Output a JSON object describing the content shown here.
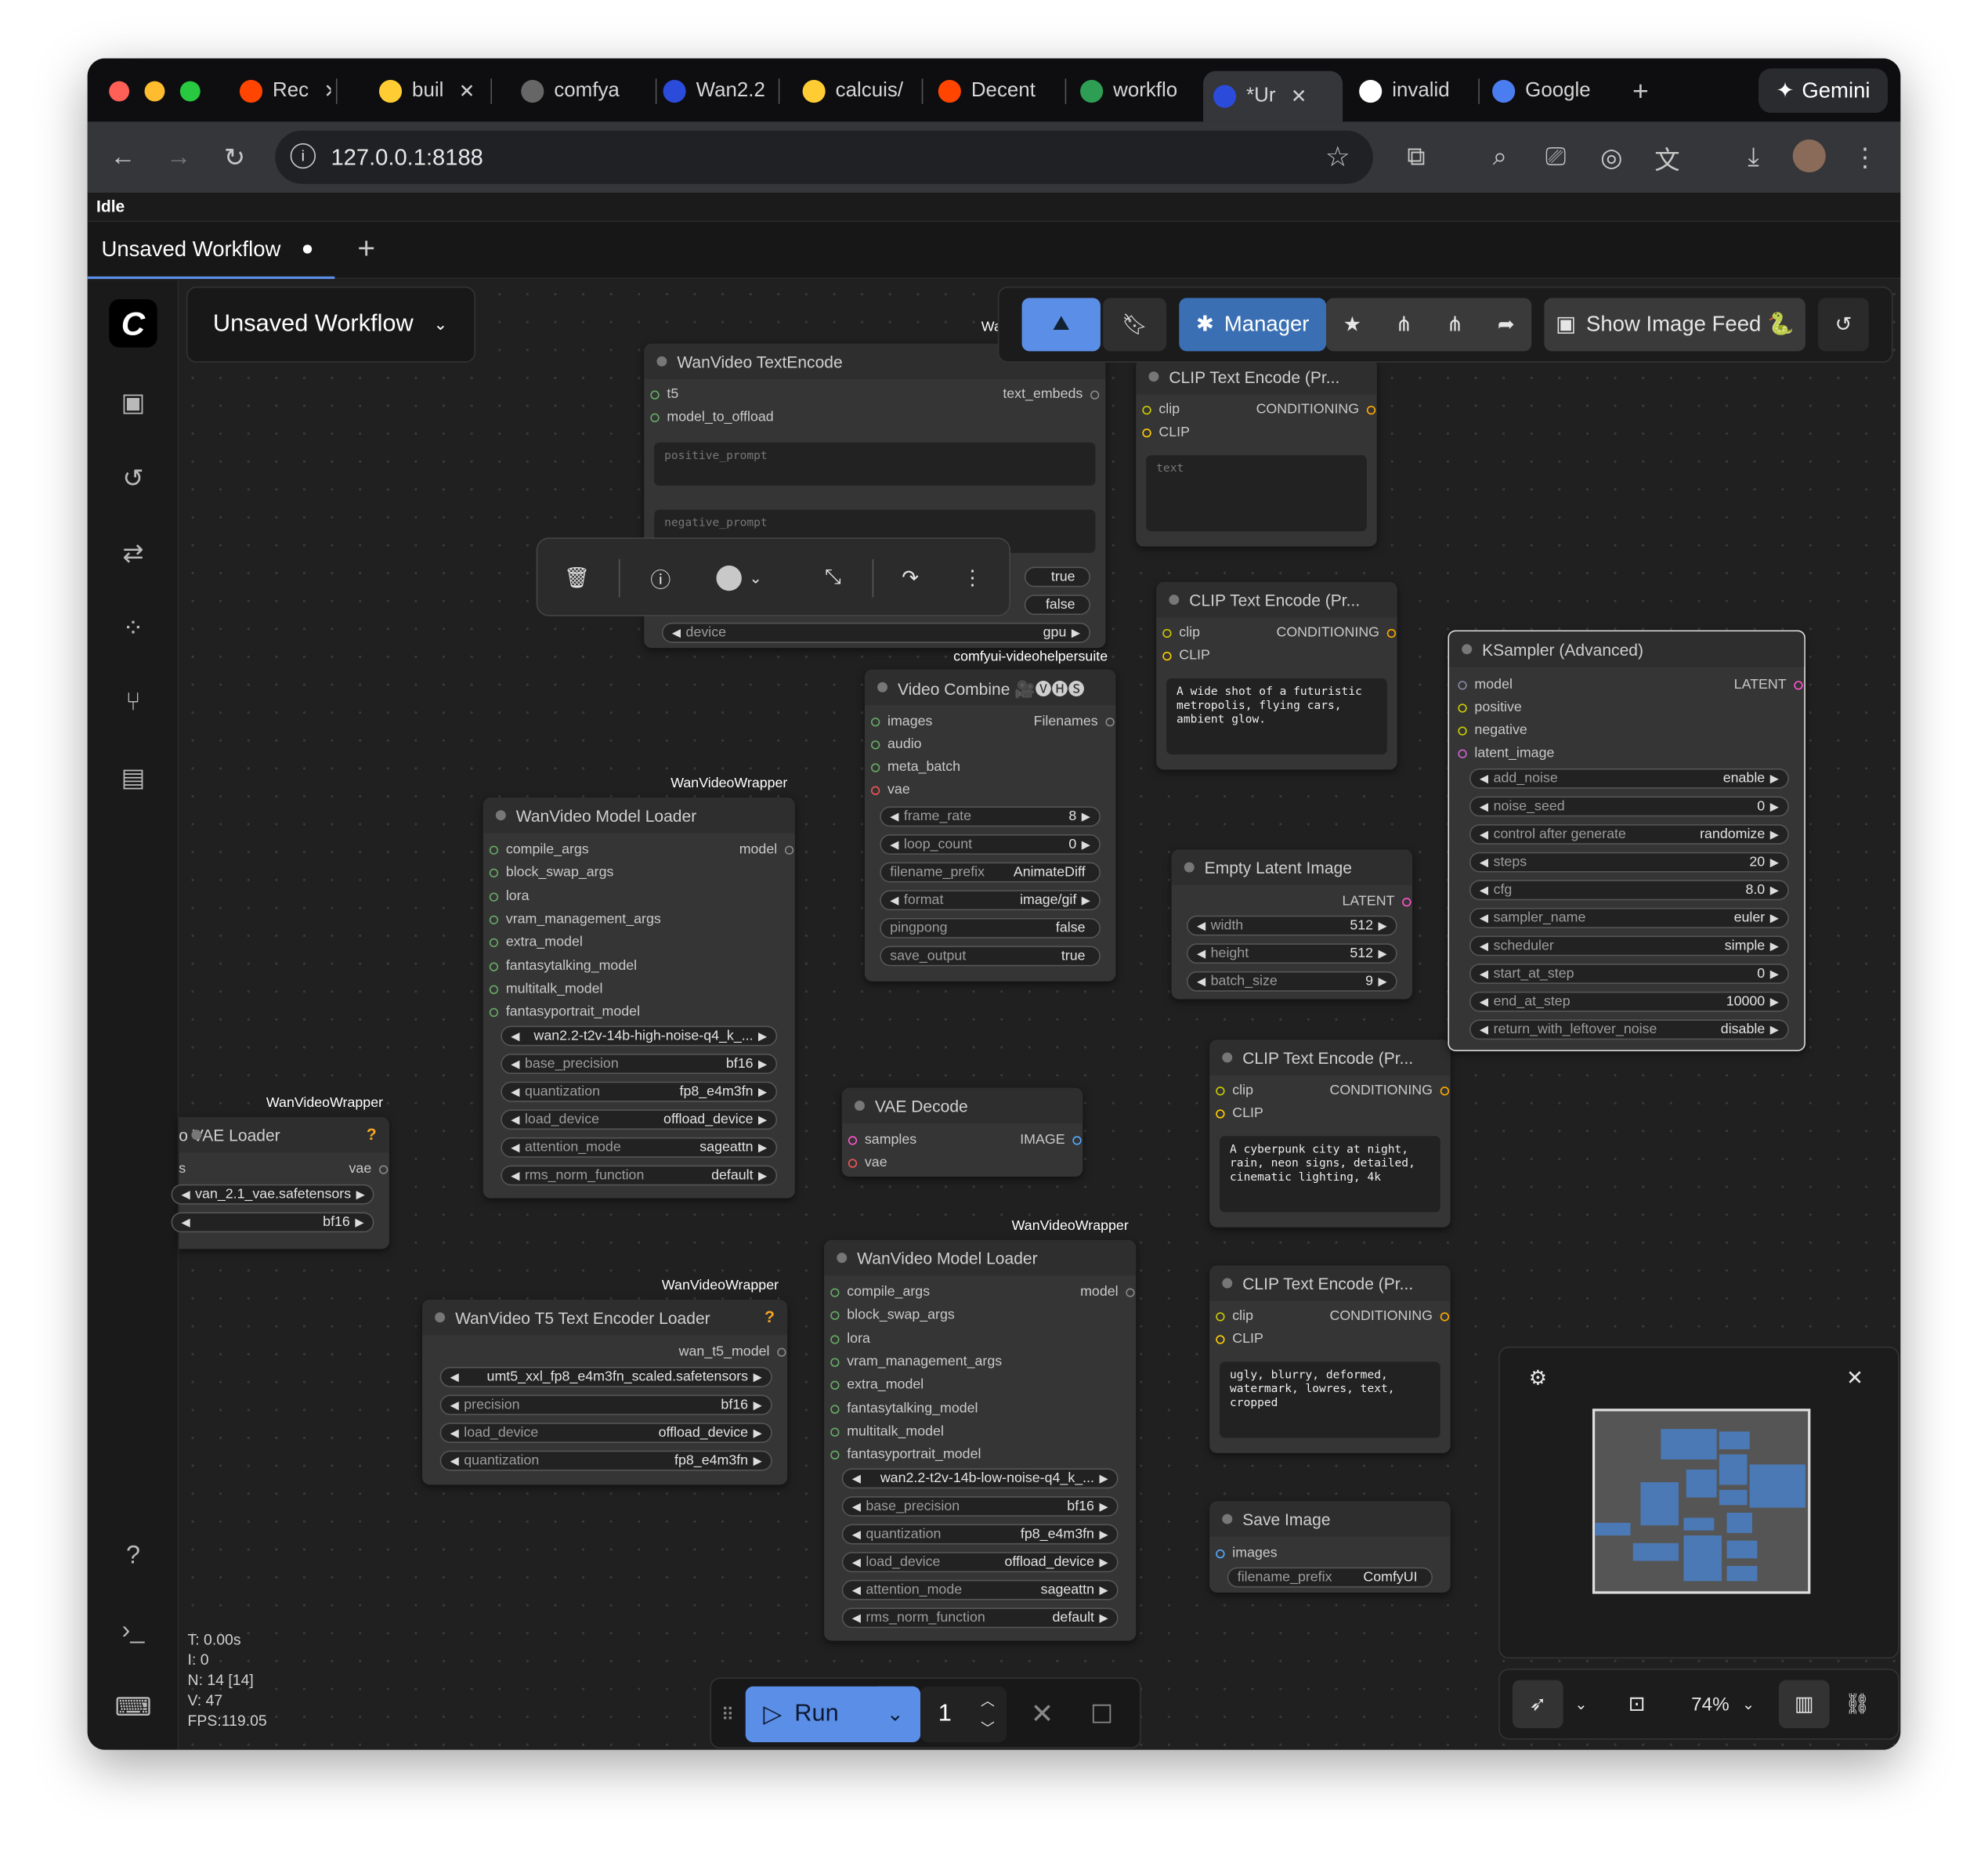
{
  "browser": {
    "tabs": [
      {
        "label": "Rec",
        "icon": "reddit-icon"
      },
      {
        "label": "buil",
        "icon": "huggingface-icon"
      },
      {
        "label": "comfya",
        "icon": "globe-icon"
      },
      {
        "label": "Wan2.2",
        "icon": "comfy-icon"
      },
      {
        "label": "calcuis/",
        "icon": "huggingface-icon"
      },
      {
        "label": "Decent",
        "icon": "reddit-icon"
      },
      {
        "label": "workflo",
        "icon": "drive-icon"
      },
      {
        "label": "*Ur",
        "icon": "comfy-icon"
      },
      {
        "label": "invalid",
        "icon": "google-icon"
      },
      {
        "label": "Google",
        "icon": "gemini-icon"
      }
    ],
    "gemini_label": "Gemini",
    "url": "127.0.0.1:8188",
    "status": "Idle"
  },
  "workflow": {
    "tab_label": "Unsaved Workflow",
    "title": "Unsaved Workflow"
  },
  "topbar": {
    "manager_label": "Manager",
    "image_feed_label": "Show Image Feed 🐍"
  },
  "nodes": {
    "textencode": {
      "title": "WanVideo TextEncode",
      "in_t5": "t5",
      "in_offload": "model_to_offload",
      "out_embeds": "text_embeds",
      "positive_ph": "positive_prompt",
      "negative_ph": "negative_prompt",
      "w_true": "true",
      "w_false": "false",
      "device_label": "device",
      "device_value": "gpu",
      "badge": "Wa"
    },
    "clip1": {
      "title": "CLIP Text Encode (Pr...",
      "in_clip": "clip",
      "out": "CONDITIONING",
      "in2": "CLIP",
      "text_ph": "text"
    },
    "clip2": {
      "title": "CLIP Text Encode (Pr...",
      "in_clip": "clip",
      "out": "CONDITIONING",
      "in2": "CLIP",
      "text": "A wide shot of a futuristic\nmetropolis, flying cars,\nambient glow."
    },
    "clip3": {
      "title": "CLIP Text Encode (Pr...",
      "in_clip": "clip",
      "out": "CONDITIONING",
      "in2": "CLIP",
      "text": "A cyberpunk city at night,\nrain, neon signs, detailed,\ncinematic lighting, 4k"
    },
    "clip4": {
      "title": "CLIP Text Encode (Pr...",
      "in_clip": "clip",
      "out": "CONDITIONING",
      "in2": "CLIP",
      "text": "ugly, blurry, deformed,\nwatermark, lowres, text,\ncropped"
    },
    "ksampler": {
      "title": "KSampler (Advanced)",
      "inputs": [
        "model",
        "positive",
        "negative",
        "latent_image"
      ],
      "output": "LATENT",
      "widgets": [
        {
          "label": "add_noise",
          "value": "enable"
        },
        {
          "label": "noise_seed",
          "value": "0"
        },
        {
          "label": "control after generate",
          "value": "randomize"
        },
        {
          "label": "steps",
          "value": "20"
        },
        {
          "label": "cfg",
          "value": "8.0"
        },
        {
          "label": "sampler_name",
          "value": "euler"
        },
        {
          "label": "scheduler",
          "value": "simple"
        },
        {
          "label": "start_at_step",
          "value": "0"
        },
        {
          "label": "end_at_step",
          "value": "10000"
        },
        {
          "label": "return_with_leftover_noise",
          "value": "disable"
        }
      ]
    },
    "videocombine": {
      "badge": "comfyui-videohelpersuite",
      "title": "Video Combine 🎥🅥🅗🅢",
      "inputs": [
        "images",
        "audio",
        "meta_batch",
        "vae"
      ],
      "output": "Filenames",
      "widgets": [
        {
          "label": "frame_rate",
          "value": "8"
        },
        {
          "label": "loop_count",
          "value": "0"
        },
        {
          "label": "filename_prefix",
          "value": "AnimateDiff"
        },
        {
          "label": "format",
          "value": "image/gif"
        },
        {
          "label": "pingpong",
          "value": "false"
        },
        {
          "label": "save_output",
          "value": "true"
        }
      ]
    },
    "latent": {
      "title": "Empty Latent Image",
      "output": "LATENT",
      "widgets": [
        {
          "label": "width",
          "value": "512"
        },
        {
          "label": "height",
          "value": "512"
        },
        {
          "label": "batch_size",
          "value": "9"
        }
      ]
    },
    "loader1": {
      "badge": "WanVideoWrapper",
      "title": "WanVideo Model Loader",
      "output": "model",
      "inputs": [
        "compile_args",
        "block_swap_args",
        "lora",
        "vram_management_args",
        "extra_model",
        "fantasytalking_model",
        "multitalk_model",
        "fantasyportrait_model"
      ],
      "widgets": [
        {
          "label": "",
          "value": "wan2.2-t2v-14b-high-noise-q4_k_..."
        },
        {
          "label": "base_precision",
          "value": "bf16"
        },
        {
          "label": "quantization",
          "value": "fp8_e4m3fn"
        },
        {
          "label": "load_device",
          "value": "offload_device"
        },
        {
          "label": "attention_mode",
          "value": "sageattn"
        },
        {
          "label": "rms_norm_function",
          "value": "default"
        }
      ]
    },
    "loader2": {
      "badge": "WanVideoWrapper",
      "title": "WanVideo Model Loader",
      "output": "model",
      "inputs": [
        "compile_args",
        "block_swap_args",
        "lora",
        "vram_management_args",
        "extra_model",
        "fantasytalking_model",
        "multitalk_model",
        "fantasyportrait_model"
      ],
      "widgets": [
        {
          "label": "",
          "value": "wan2.2-t2v-14b-low-noise-q4_k_..."
        },
        {
          "label": "base_precision",
          "value": "bf16"
        },
        {
          "label": "quantization",
          "value": "fp8_e4m3fn"
        },
        {
          "label": "load_device",
          "value": "offload_device"
        },
        {
          "label": "attention_mode",
          "value": "sageattn"
        },
        {
          "label": "rms_norm_function",
          "value": "default"
        }
      ]
    },
    "vaeloader": {
      "badge": "WanVideoWrapper",
      "title": "o VAE Loader",
      "help": "?",
      "in": "s",
      "out": "vae",
      "w1": "van_2.1_vae.safetensors",
      "w2": "bf16"
    },
    "vaedecode": {
      "title": "VAE Decode",
      "in1": "samples",
      "in2": "vae",
      "out": "IMAGE"
    },
    "t5loader": {
      "badge": "WanVideoWrapper",
      "title": "WanVideo T5 Text Encoder Loader",
      "help": "?",
      "out": "wan_t5_model",
      "widgets": [
        {
          "label": "",
          "value": "umt5_xxl_fp8_e4m3fn_scaled.safetensors"
        },
        {
          "label": "precision",
          "value": "bf16"
        },
        {
          "label": "load_device",
          "value": "offload_device"
        },
        {
          "label": "quantization",
          "value": "fp8_e4m3fn"
        }
      ]
    },
    "save": {
      "title": "Save Image",
      "in": "images",
      "w_label": "filename_prefix",
      "w_value": "ComfyUI"
    }
  },
  "stats": {
    "t": "T: 0.00s",
    "i": "I: 0",
    "n": "N: 14 [14]",
    "v": "V: 47",
    "fps": "FPS:119.05"
  },
  "runbar": {
    "run_label": "Run",
    "count": "1"
  },
  "zoom": {
    "label": "74%"
  },
  "colors": {
    "accent": "#5b8ee6",
    "canvas": "#202020",
    "node": "#353535"
  }
}
